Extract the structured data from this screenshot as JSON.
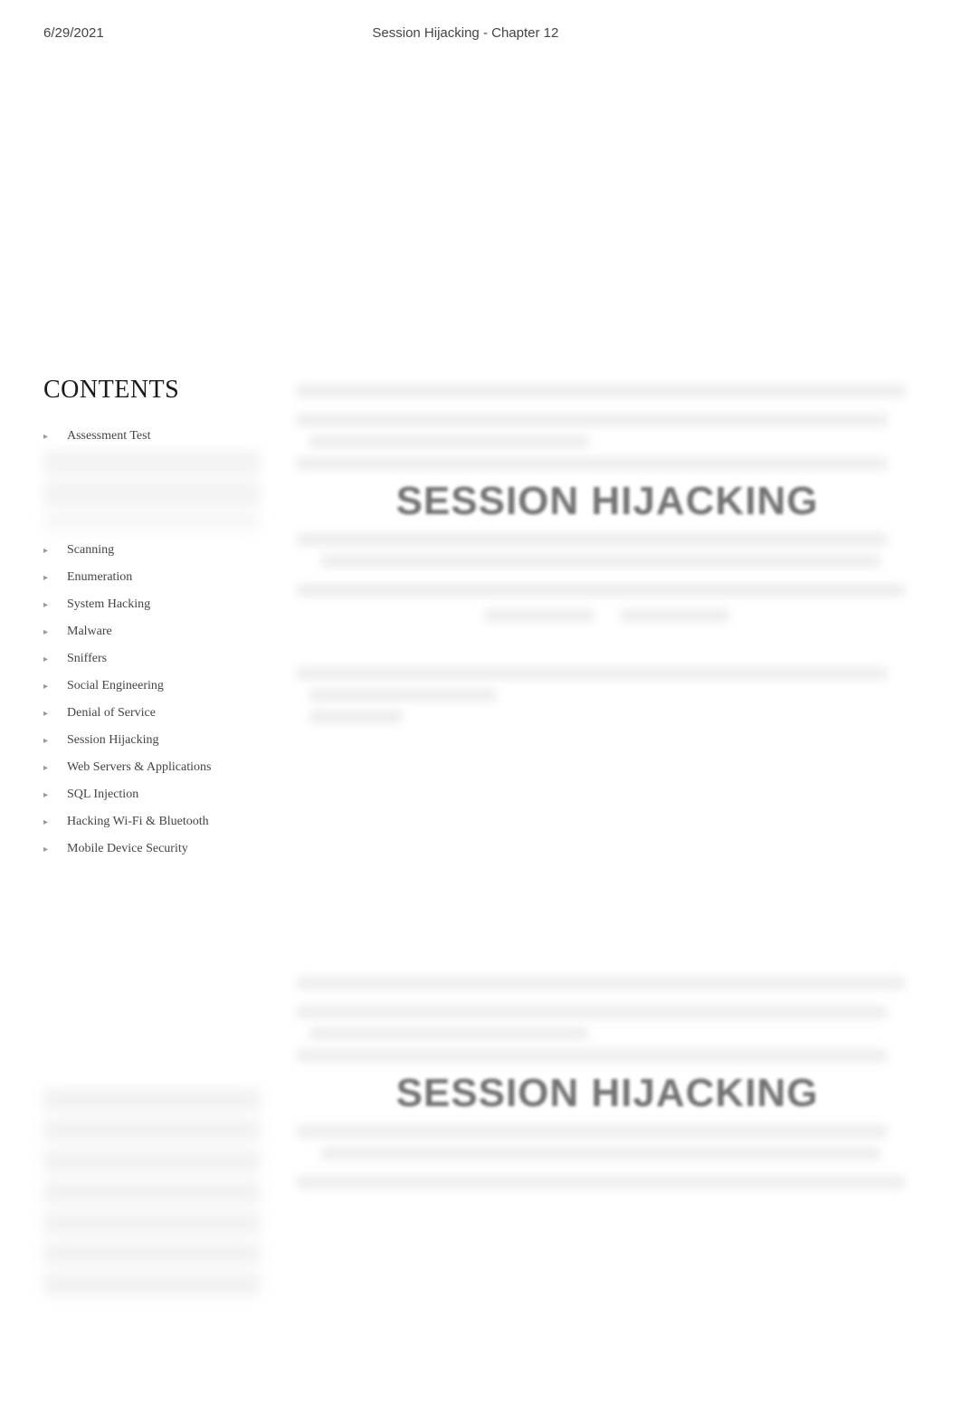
{
  "header": {
    "date": "6/29/2021",
    "title": "Session Hijacking - Chapter 12"
  },
  "sidebar": {
    "heading": "CONTENTS",
    "items": [
      {
        "label": "Assessment Test",
        "visible": true
      },
      {
        "label": "",
        "visible": false
      },
      {
        "label": "",
        "visible": false
      },
      {
        "label": "",
        "visible": false
      },
      {
        "label": "Scanning",
        "visible": true
      },
      {
        "label": "Enumeration",
        "visible": true
      },
      {
        "label": "System Hacking",
        "visible": true
      },
      {
        "label": "Malware",
        "visible": true
      },
      {
        "label": "Sniffers",
        "visible": true
      },
      {
        "label": "Social Engineering",
        "visible": true
      },
      {
        "label": "Denial of Service",
        "visible": true
      },
      {
        "label": "Session Hijacking",
        "visible": true
      },
      {
        "label": "Web Servers & Applications",
        "visible": true
      },
      {
        "label": "SQL Injection",
        "visible": true
      },
      {
        "label": "Hacking Wi-Fi & Bluetooth",
        "visible": true
      },
      {
        "label": "Mobile Device Security",
        "visible": true
      }
    ]
  },
  "watermark": "SESSION HIJACKING"
}
